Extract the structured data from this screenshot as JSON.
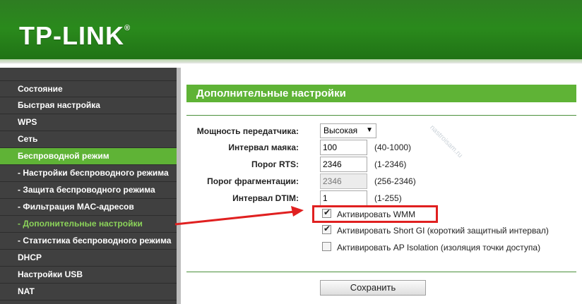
{
  "brand": {
    "name": "TP-LINK",
    "trademark": "®"
  },
  "sidebar": {
    "items": [
      {
        "label": "Состояние"
      },
      {
        "label": "Быстрая настройка"
      },
      {
        "label": "WPS"
      },
      {
        "label": "Сеть"
      },
      {
        "label": "Беспроводной режим"
      },
      {
        "label": "- Настройки беспроводного режима"
      },
      {
        "label": "- Защита беспроводного режима"
      },
      {
        "label": "- Фильтрация MAC-адресов"
      },
      {
        "label": "- Дополнительные настройки"
      },
      {
        "label": "- Статистика беспроводного режима"
      },
      {
        "label": "DHCP"
      },
      {
        "label": "Настройки USB"
      },
      {
        "label": "NAT"
      }
    ]
  },
  "page": {
    "title": "Дополнительные настройки"
  },
  "form": {
    "tx_power": {
      "label": "Мощность передатчика:",
      "value": "Высокая"
    },
    "beacon": {
      "label": "Интервал маяка:",
      "value": "100",
      "range": "(40-1000)"
    },
    "rts": {
      "label": "Порог RTS:",
      "value": "2346",
      "range": "(1-2346)"
    },
    "frag": {
      "label": "Порог фрагментации:",
      "value": "2346",
      "range": "(256-2346)"
    },
    "dtim": {
      "label": "Интервал DTIM:",
      "value": "1",
      "range": "(1-255)"
    },
    "wmm": {
      "label": "Активировать WMM",
      "checked": true
    },
    "short_gi": {
      "label": "Активировать Short GI (короткий защитный интервал)",
      "checked": true
    },
    "ap_isolation": {
      "label": "Активировать AP Isolation (изоляция точки доступа)",
      "checked": false
    },
    "save_label": "Сохранить"
  },
  "watermark": "nastroisam.ru",
  "colors": {
    "header_green": "#2a8a1c",
    "accent_green": "#5fb336",
    "sidebar_bg": "#404040",
    "highlight_red": "#e02020"
  }
}
